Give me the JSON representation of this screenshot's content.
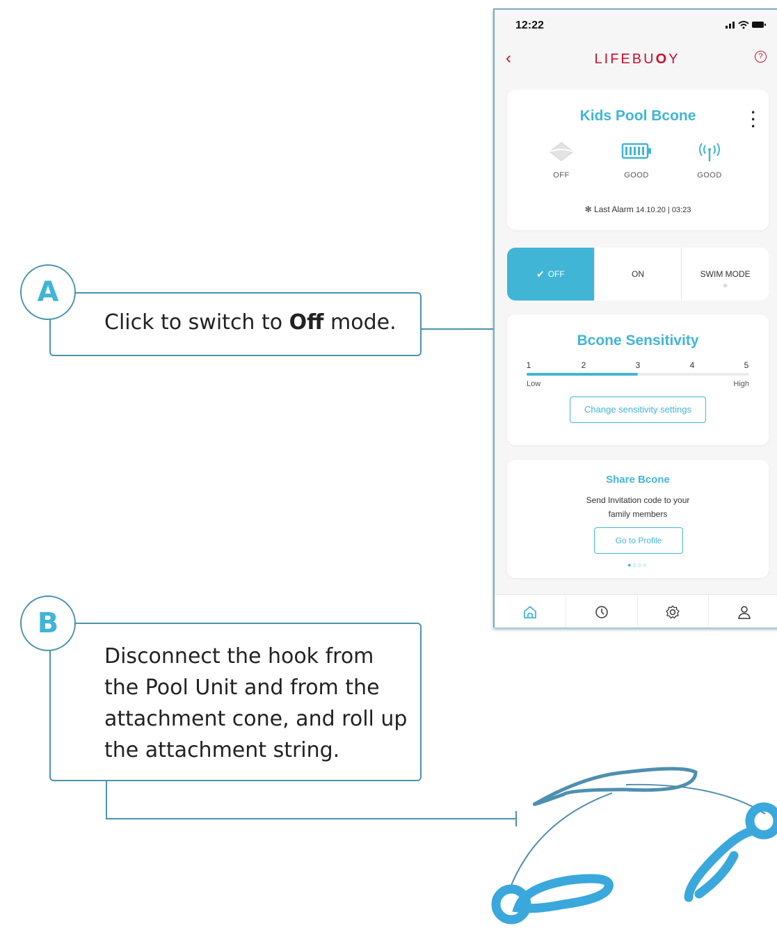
{
  "callouts": {
    "a": {
      "letter": "A",
      "text_before": "Click to switch to ",
      "text_bold": "Off",
      "text_after": " mode."
    },
    "b": {
      "letter": "B",
      "text": "Disconnect the hook from the Pool Unit and from the attachment cone, and roll up the attachment string."
    }
  },
  "phone": {
    "status": {
      "time": "12:22",
      "icons": "signal-wifi-battery"
    },
    "header": {
      "brand_prefix": "LIFEBU",
      "brand_o": "O",
      "brand_suffix": "Y",
      "back_icon": "chevron-left-icon",
      "help_icon": "help-circle-icon"
    },
    "device": {
      "name": "Kids Pool Bcone",
      "stats": [
        {
          "icon": "bcone-icon",
          "label": "OFF"
        },
        {
          "icon": "battery-icon",
          "label": "GOOD"
        },
        {
          "icon": "signal-icon",
          "label": "GOOD"
        }
      ],
      "last_alarm_label": "Last Alarm",
      "last_alarm_value": "14.10.20 | 03:23"
    },
    "modes": [
      {
        "label": "OFF",
        "active": true
      },
      {
        "label": "ON",
        "active": false
      },
      {
        "label": "SWIM MODE",
        "active": false
      }
    ],
    "sensitivity": {
      "title": "Bcone Sensitivity",
      "ticks": [
        "1",
        "2",
        "3",
        "4",
        "5"
      ],
      "level": 3,
      "low_label": "Low",
      "high_label": "High",
      "button": "Change sensitivity settings"
    },
    "share": {
      "title": "Share Bcone",
      "text": "Send Invitation code to your family members",
      "button": "Go to Profile",
      "page_count": 4,
      "page_index": 1
    },
    "tabs": [
      "home-icon",
      "history-icon",
      "settings-icon",
      "profile-icon"
    ]
  },
  "colors": {
    "accent": "#41b5d6",
    "brand": "#c8102e",
    "outline": "#4a93ad"
  }
}
